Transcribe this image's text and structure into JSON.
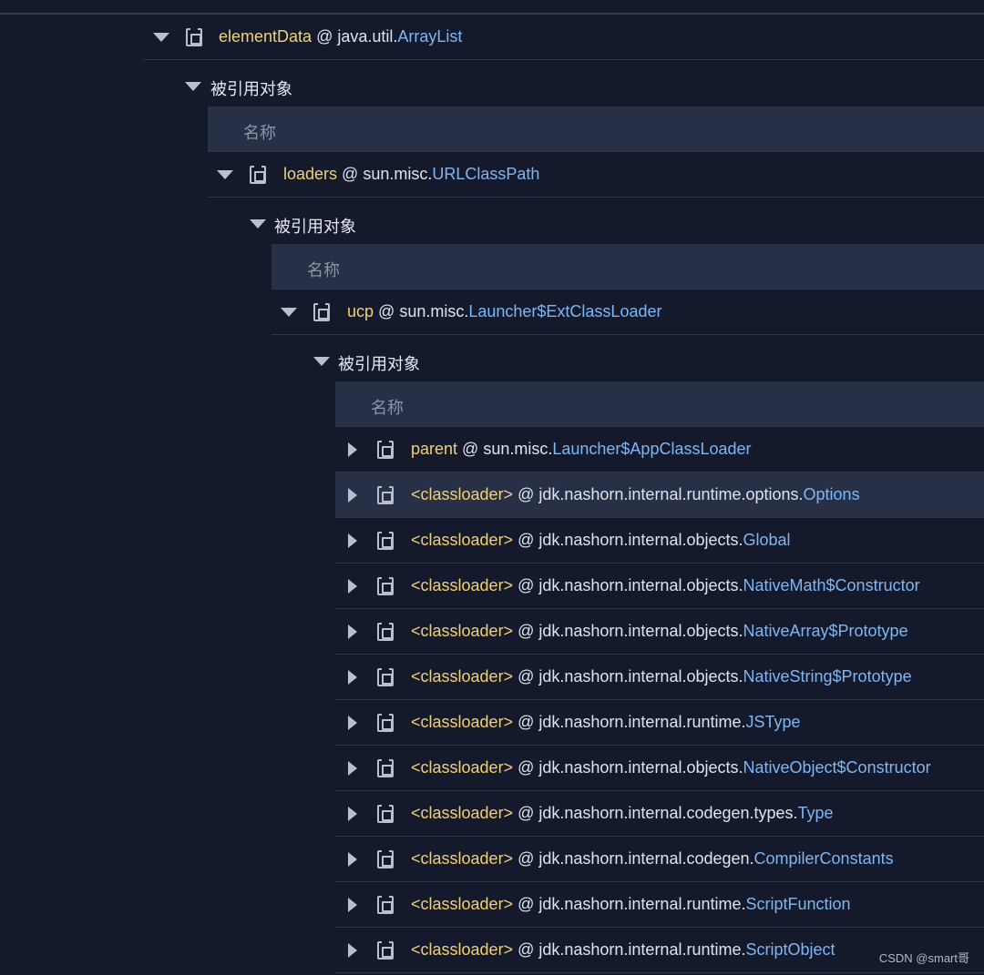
{
  "tree": {
    "root": {
      "field": "elementData",
      "at": " @ ",
      "package": "java.util.",
      "class": "ArrayList"
    },
    "level1": {
      "section_label": "被引用对象",
      "header_label": "名称",
      "object": {
        "field": "loaders",
        "at": " @ ",
        "package": "sun.misc.",
        "class": "URLClassPath"
      }
    },
    "level2": {
      "section_label": "被引用对象",
      "header_label": "名称",
      "object": {
        "field": "ucp",
        "at": " @ ",
        "package": "sun.misc.",
        "class": "Launcher$ExtClassLoader"
      }
    },
    "level3": {
      "section_label": "被引用对象",
      "header_label": "名称",
      "items": [
        {
          "field": "parent",
          "at": " @ ",
          "package": "sun.misc.",
          "class": "Launcher$AppClassLoader"
        },
        {
          "field": "<classloader>",
          "at": " @ ",
          "package": "jdk.nashorn.internal.runtime.options.",
          "class": "Options"
        },
        {
          "field": "<classloader>",
          "at": " @ ",
          "package": "jdk.nashorn.internal.objects.",
          "class": "Global"
        },
        {
          "field": "<classloader>",
          "at": " @ ",
          "package": "jdk.nashorn.internal.objects.",
          "class": "NativeMath$Constructor"
        },
        {
          "field": "<classloader>",
          "at": " @ ",
          "package": "jdk.nashorn.internal.objects.",
          "class": "NativeArray$Prototype"
        },
        {
          "field": "<classloader>",
          "at": " @ ",
          "package": "jdk.nashorn.internal.objects.",
          "class": "NativeString$Prototype"
        },
        {
          "field": "<classloader>",
          "at": " @ ",
          "package": "jdk.nashorn.internal.runtime.",
          "class": "JSType"
        },
        {
          "field": "<classloader>",
          "at": " @ ",
          "package": "jdk.nashorn.internal.objects.",
          "class": "NativeObject$Constructor"
        },
        {
          "field": "<classloader>",
          "at": " @ ",
          "package": "jdk.nashorn.internal.codegen.types.",
          "class": "Type"
        },
        {
          "field": "<classloader>",
          "at": " @ ",
          "package": "jdk.nashorn.internal.codegen.",
          "class": "CompilerConstants"
        },
        {
          "field": "<classloader>",
          "at": " @ ",
          "package": "jdk.nashorn.internal.runtime.",
          "class": "ScriptFunction"
        },
        {
          "field": "<classloader>",
          "at": " @ ",
          "package": "jdk.nashorn.internal.runtime.",
          "class": "ScriptObject"
        }
      ]
    }
  },
  "watermark": "CSDN @smart哥",
  "colors": {
    "background": "#141a2c",
    "header_bg": "#283048",
    "field": "#f0d078",
    "class": "#7eb6f4",
    "text": "#dfe3ec"
  }
}
